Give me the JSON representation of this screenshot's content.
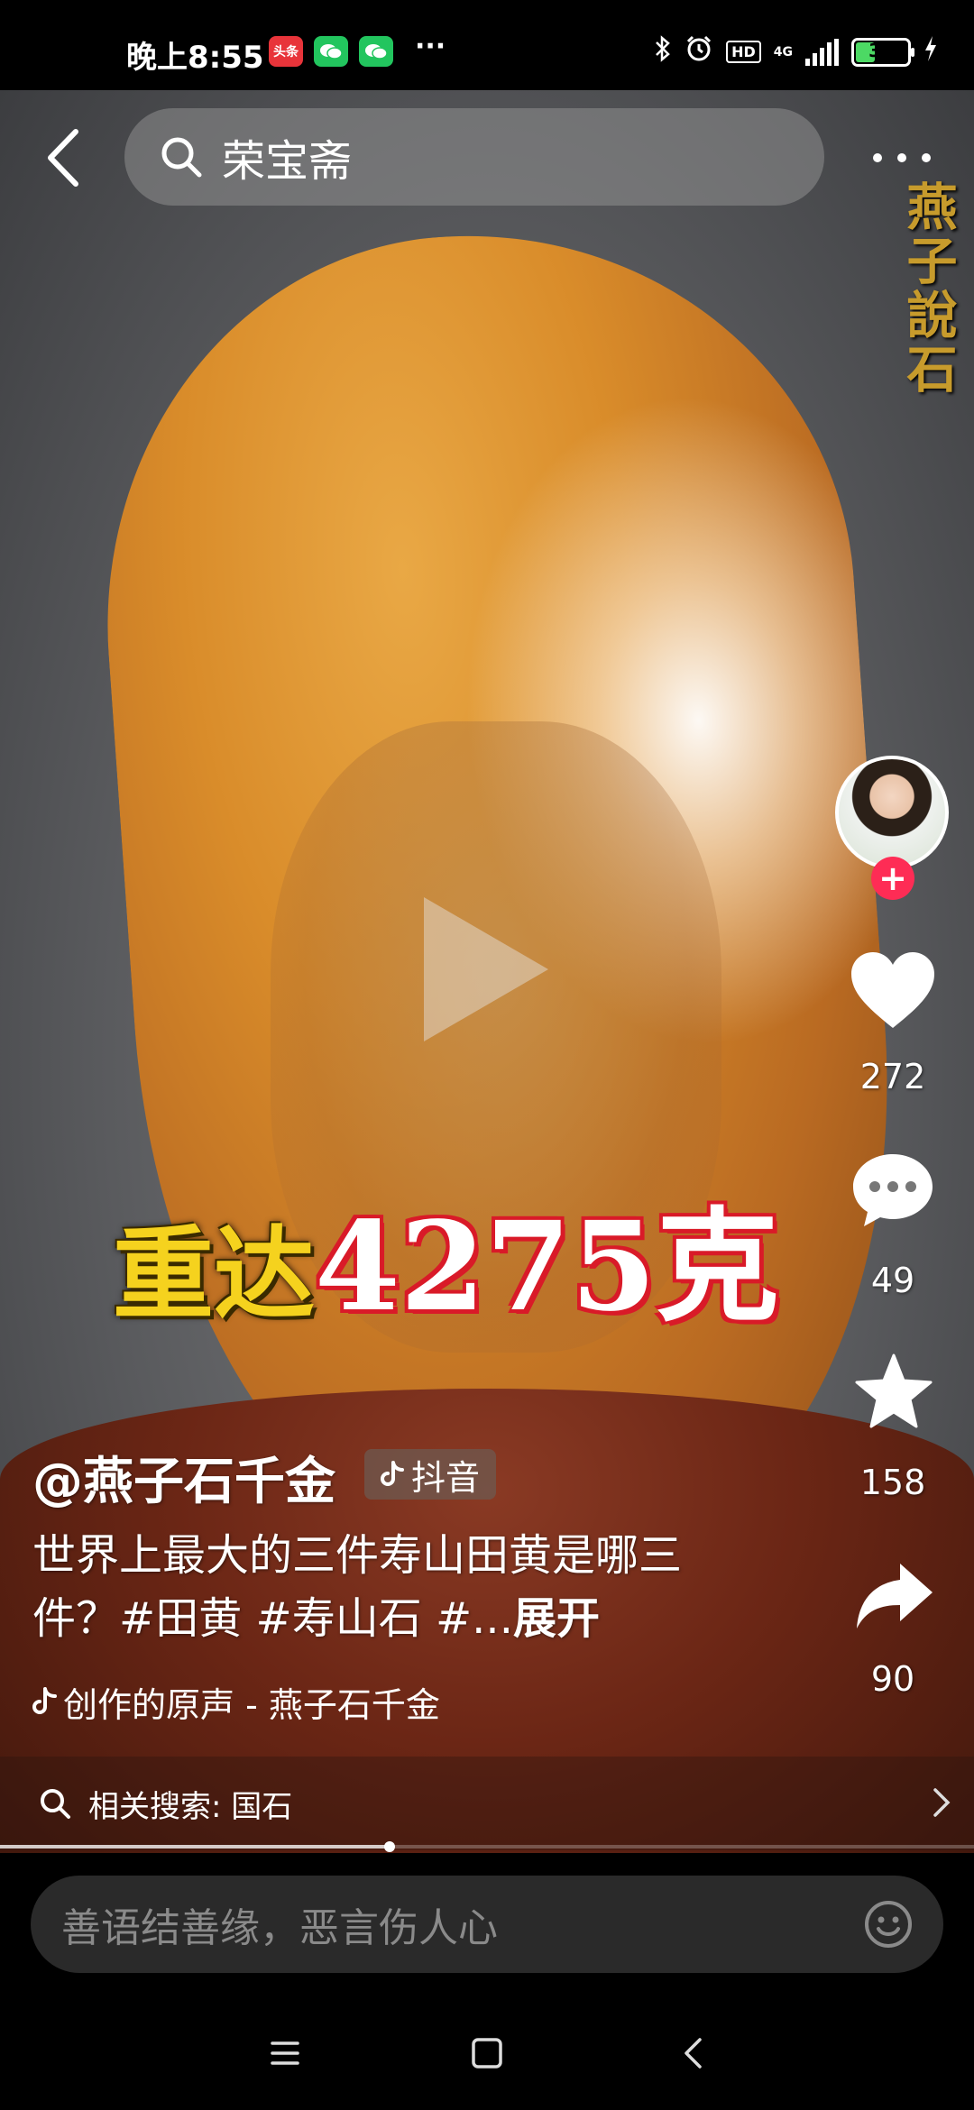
{
  "status_bar": {
    "time": "晚上8:55",
    "apps": [
      {
        "name": "toutiao",
        "label": "头条",
        "color": "#e8343a"
      },
      {
        "name": "wechat",
        "label": "",
        "color": "#22c55e"
      },
      {
        "name": "wechat",
        "label": "",
        "color": "#22c55e"
      }
    ],
    "more": "···",
    "network": "4G",
    "hd": "HD",
    "battery": "38",
    "battery_level": 0.38
  },
  "header": {
    "search_query": "荣宝斋"
  },
  "video": {
    "channel_watermark": "燕子說石",
    "caption_prefix": "重达",
    "caption_highlight": "4275克"
  },
  "actions": {
    "likes": "272",
    "comments": "49",
    "favorites": "158",
    "shares": "90"
  },
  "post": {
    "author": "@燕子石千金",
    "source_tag": "抖音",
    "description": "世界上最大的三件寿山田黄是哪三件？#田黄 #寿山石 #...",
    "expand": "展开",
    "music": "创作的原声 - 燕子石千金",
    "playback_progress": 0.4
  },
  "related_search": {
    "label": "相关搜索: 国石"
  },
  "comment": {
    "placeholder": "善语结善缘，恶言伤人心"
  },
  "colors": {
    "accent_red": "#fe2c55",
    "caption_yellow": "#f5d21e",
    "caption_red": "#d91a28"
  }
}
